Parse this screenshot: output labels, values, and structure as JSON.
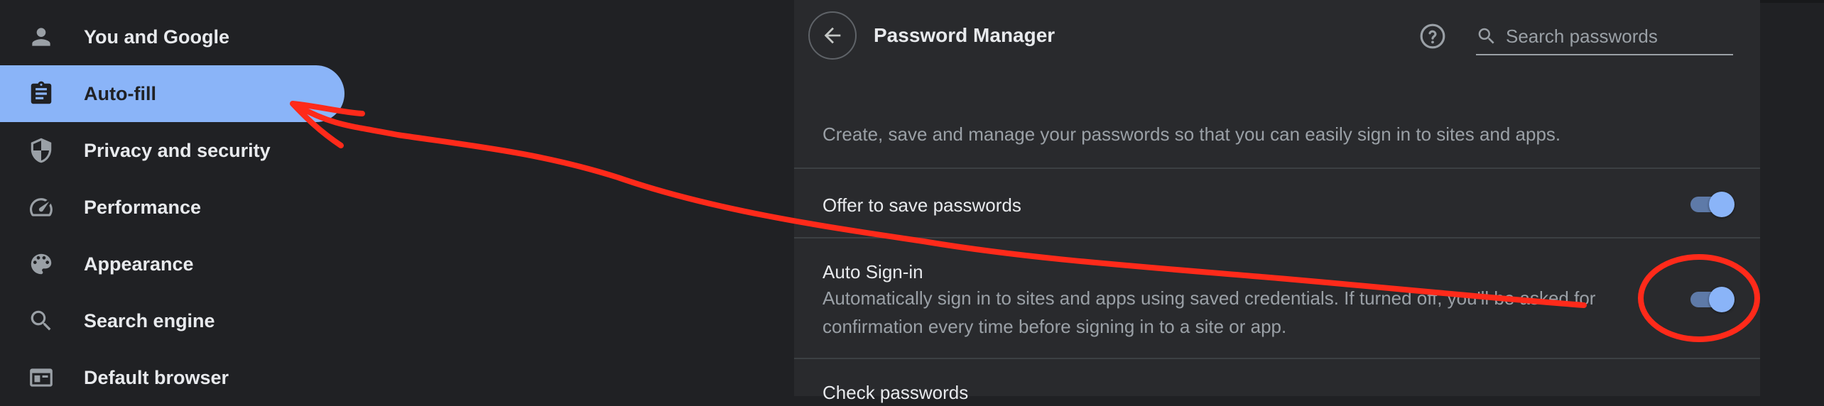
{
  "sidebar": {
    "items": [
      {
        "label": "You and Google",
        "icon": "person-icon"
      },
      {
        "label": "Auto-fill",
        "icon": "clipboard-icon",
        "active": true
      },
      {
        "label": "Privacy and security",
        "icon": "shield-icon"
      },
      {
        "label": "Performance",
        "icon": "speedometer-icon"
      },
      {
        "label": "Appearance",
        "icon": "palette-icon"
      },
      {
        "label": "Search engine",
        "icon": "search-icon"
      },
      {
        "label": "Default browser",
        "icon": "browser-window-icon"
      }
    ]
  },
  "header": {
    "title": "Password Manager",
    "search_placeholder": "Search passwords",
    "search_value": ""
  },
  "description": "Create, save and manage your passwords so that you can easily sign in to sites and apps.",
  "settings": [
    {
      "title": "Offer to save passwords",
      "enabled": true
    },
    {
      "title": "Auto Sign-in",
      "subtitle": "Automatically sign in to sites and apps using saved credentials. If turned off, you'll be asked for confirmation every time before signing in to a site or app.",
      "enabled": true
    },
    {
      "title": "Check passwords"
    }
  ],
  "colors": {
    "accent": "#8ab4f8",
    "background": "#202124",
    "panel": "#292a2d",
    "annotation": "#ff2a1a"
  }
}
